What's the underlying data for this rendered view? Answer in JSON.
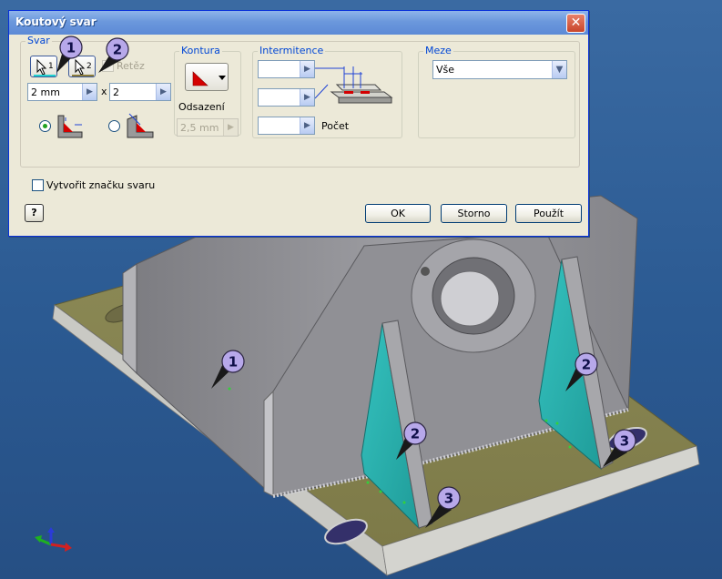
{
  "dialog": {
    "title": "Koutový svar",
    "close_label": "✕",
    "help_label": "?",
    "svar": {
      "label": "Svar",
      "select1_label": "1",
      "select2_label": "2",
      "chain_label": "Řetěz",
      "size_value": "2 mm",
      "times_label": "x",
      "count_value": "2"
    },
    "kontura": {
      "label": "Kontura",
      "offset_label": "Odsazení",
      "offset_value": "2,5 mm"
    },
    "intermitence": {
      "label": "Intermitence",
      "field1_value": "",
      "field2_value": "",
      "field3_value": "",
      "count_label": "Počet"
    },
    "meze": {
      "label": "Meze",
      "selected": "Vše"
    },
    "create_symbol_label": "Vytvořit značku svaru",
    "buttons": {
      "ok": "OK",
      "cancel": "Storno",
      "apply": "Použít"
    }
  },
  "callouts": {
    "dialog_1": "1",
    "dialog_2": "2",
    "model_1": "1",
    "model_2a": "2",
    "model_2b": "2",
    "model_3a": "3",
    "model_3b": "3"
  },
  "colors": {
    "viewport": "#2e5a8e",
    "base_plate": "#8f8a58",
    "selected_face": "#2fb3b0",
    "body": "#8f8f93",
    "callout_fill": "#b7a8ea"
  }
}
